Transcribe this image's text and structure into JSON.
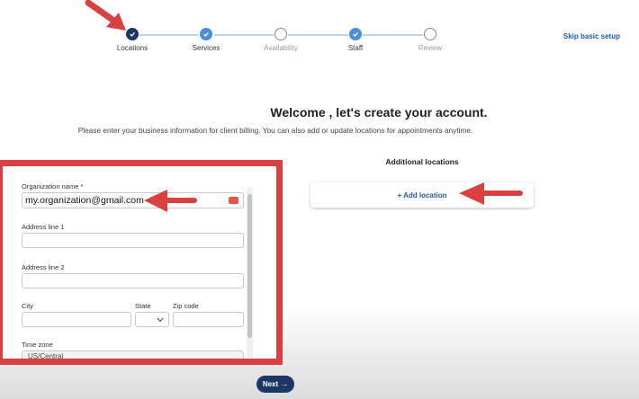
{
  "stepper": {
    "steps": [
      {
        "label": "Locations",
        "state": "current"
      },
      {
        "label": "Services",
        "state": "done"
      },
      {
        "label": "Availability",
        "state": "todo"
      },
      {
        "label": "Staff",
        "state": "done"
      },
      {
        "label": "Review",
        "state": "todo"
      }
    ],
    "skip_label": "Skip basic setup"
  },
  "header": {
    "title": "Welcome , let's create your account.",
    "subtitle": "Please enter your business information for client billing. You can also add or update locations for appointments anytime."
  },
  "form": {
    "org_label": "Organization name *",
    "org_value": "my.organization@gmail.com",
    "address1_label": "Address line 1",
    "address2_label": "Address line 2",
    "city_label": "City",
    "state_label": "State",
    "zip_label": "Zip code",
    "timezone_label": "Time zone",
    "timezone_value": "US/Central"
  },
  "locations": {
    "title": "Additional locations",
    "add_label": "+ Add location"
  },
  "footer": {
    "next_label": "Next",
    "next_arrow": "→"
  },
  "colors": {
    "annotation_red": "#d9403f",
    "primary_navy": "#1c3766",
    "step_done_blue": "#4a90d9",
    "link_blue": "#1f5aa8"
  }
}
